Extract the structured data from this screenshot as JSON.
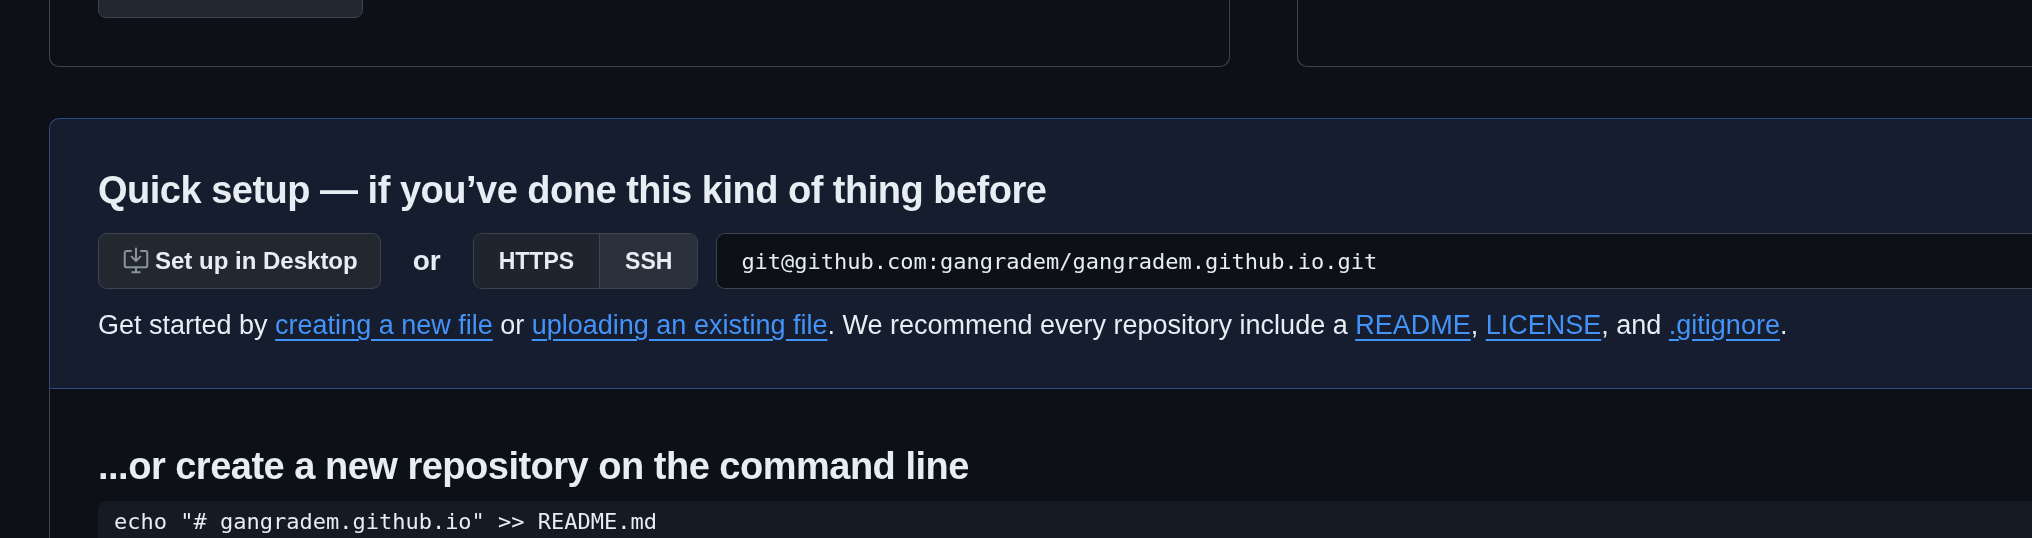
{
  "setup": {
    "title": "Quick setup — if you’ve done this kind of thing before",
    "desktop_button": "Set up in Desktop",
    "or": "or",
    "protocols": [
      {
        "label": "HTTPS",
        "selected": false
      },
      {
        "label": "SSH",
        "selected": true
      }
    ],
    "clone_url": "git@github.com:gangradem/gangradem.github.io.git",
    "help": [
      {
        "kind": "text",
        "text": "Get started by "
      },
      {
        "kind": "link",
        "text": "creating a new file"
      },
      {
        "kind": "text",
        "text": " or "
      },
      {
        "kind": "link",
        "text": "uploading an existing file"
      },
      {
        "kind": "text",
        "text": ". We recommend every repository include a "
      },
      {
        "kind": "link",
        "text": "README"
      },
      {
        "kind": "text",
        "text": ", "
      },
      {
        "kind": "link",
        "text": "LICENSE"
      },
      {
        "kind": "text",
        "text": ", and "
      },
      {
        "kind": "link",
        "text": ".gitignore"
      },
      {
        "kind": "text",
        "text": "."
      }
    ]
  },
  "command_line": {
    "title": "...or create a new repository on the command line",
    "code": "echo \"# gangradem.github.io\" >> README.md"
  }
}
